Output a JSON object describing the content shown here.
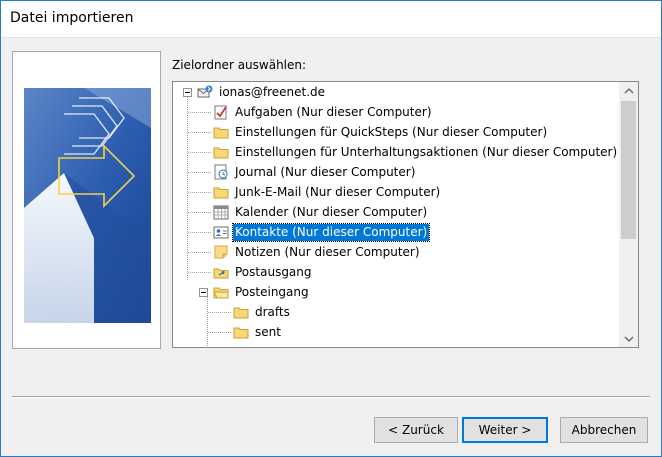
{
  "window": {
    "title": "Datei importieren"
  },
  "target_label": "Zielordner auswählen:",
  "tree": {
    "root": {
      "label": "ionas@freenet.de",
      "icon": "mailbox-icon"
    },
    "items": [
      {
        "label": "Aufgaben (Nur dieser Computer)",
        "icon": "tasks-icon"
      },
      {
        "label": "Einstellungen für QuickSteps (Nur dieser Computer)",
        "icon": "folder-icon"
      },
      {
        "label": "Einstellungen für Unterhaltungsaktionen (Nur dieser Computer)",
        "icon": "folder-icon"
      },
      {
        "label": "Journal (Nur dieser Computer)",
        "icon": "journal-icon"
      },
      {
        "label": "Junk-E-Mail (Nur dieser Computer)",
        "icon": "folder-icon"
      },
      {
        "label": "Kalender (Nur dieser Computer)",
        "icon": "calendar-icon"
      },
      {
        "label": "Kontakte (Nur dieser Computer)",
        "icon": "contacts-icon",
        "selected": true
      },
      {
        "label": "Notizen (Nur dieser Computer)",
        "icon": "notes-icon"
      },
      {
        "label": "Postausgang",
        "icon": "outbox-icon"
      },
      {
        "label": "Posteingang",
        "icon": "inbox-icon",
        "expanded": true
      }
    ],
    "inbox_children": [
      {
        "label": "drafts",
        "icon": "folder-icon"
      },
      {
        "label": "sent",
        "icon": "folder-icon"
      }
    ]
  },
  "buttons": {
    "back": "< Zurück",
    "next": "Weiter >",
    "cancel": "Abbrechen"
  },
  "colors": {
    "selection": "#0078d7",
    "folder": "#f8d775",
    "window_border": "#2b79c7"
  }
}
